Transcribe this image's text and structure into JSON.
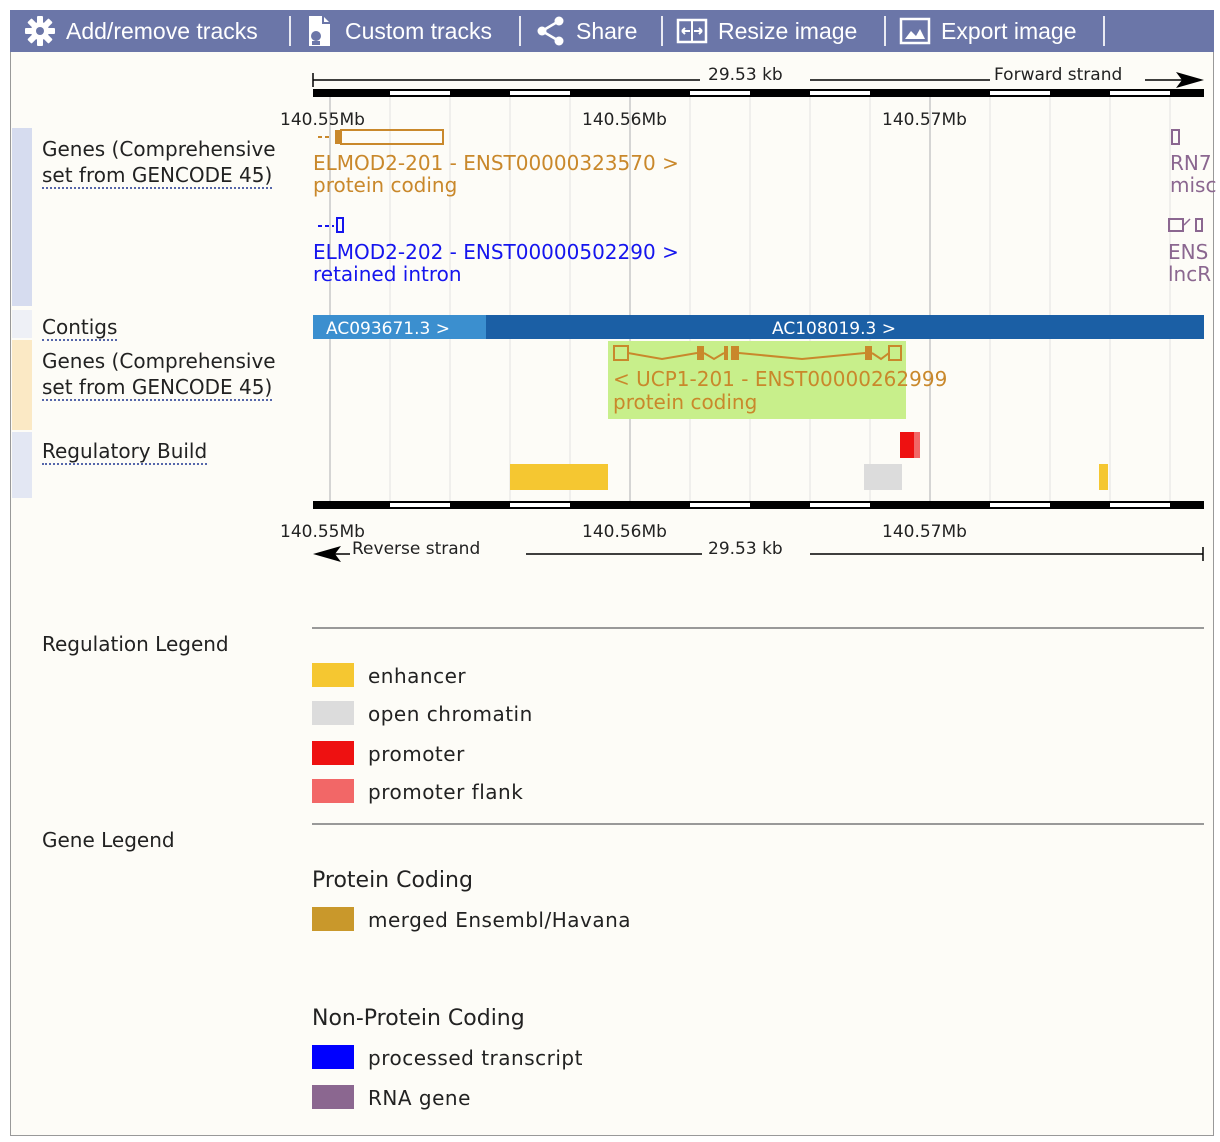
{
  "toolbar": {
    "add_remove": "Add/remove tracks",
    "custom_tracks": "Custom tracks",
    "share": "Share",
    "resize": "Resize image",
    "export": "Export image"
  },
  "ruler": {
    "length": "29.53 kb",
    "forward": "Forward strand",
    "reverse": "Reverse strand",
    "ticks": [
      "140.55Mb",
      "140.56Mb",
      "140.57Mb"
    ]
  },
  "tracks": {
    "genes_top_label": [
      "Genes (Comprehensive",
      "set from GENCODE 45)"
    ],
    "contigs_label": "Contigs",
    "genes_bottom_label": [
      "Genes (Comprehensive",
      "set from GENCODE 45)"
    ],
    "regulatory_label": "Regulatory Build"
  },
  "features": {
    "elmod2_201_name": "ELMOD2-201 - ENST00000323570 >",
    "elmod2_201_type": "protein coding",
    "elmod2_202_name": "ELMOD2-202 - ENST00000502290 >",
    "elmod2_202_type": "retained intron",
    "rn7_name": "RN7",
    "rn7_type": "misc",
    "ens_name": "ENS",
    "ens_type": "lncR",
    "contig_1": "AC093671.3 >",
    "contig_2": "AC108019.3 >",
    "ucp1_name": "< UCP1-201 - ENST00000262999",
    "ucp1_type": "protein coding"
  },
  "regulation_legend": {
    "title": "Regulation Legend",
    "items": [
      {
        "label": "enhancer",
        "color": "#f5c731"
      },
      {
        "label": "open chromatin",
        "color": "#dcdcdc"
      },
      {
        "label": "promoter",
        "color": "#ee1111"
      },
      {
        "label": "promoter flank",
        "color": "#f26767"
      }
    ]
  },
  "gene_legend": {
    "title": "Gene Legend",
    "protein_coding": "Protein Coding",
    "merged": {
      "label": "merged Ensembl/Havana",
      "color": "#c9982b"
    },
    "non_protein_coding": "Non-Protein Coding",
    "processed": {
      "label": "processed transcript",
      "color": "#0000ff"
    },
    "rna_gene": {
      "label": "RNA gene",
      "color": "#8b6790"
    }
  },
  "colors": {
    "toolbar": "#6b76a8",
    "gene_gold": "#c9882b",
    "gene_blue": "#1515ee",
    "contig_light": "#3b8fcf",
    "contig_dark": "#1b5fa5",
    "highlight": "#c8ef8b"
  }
}
